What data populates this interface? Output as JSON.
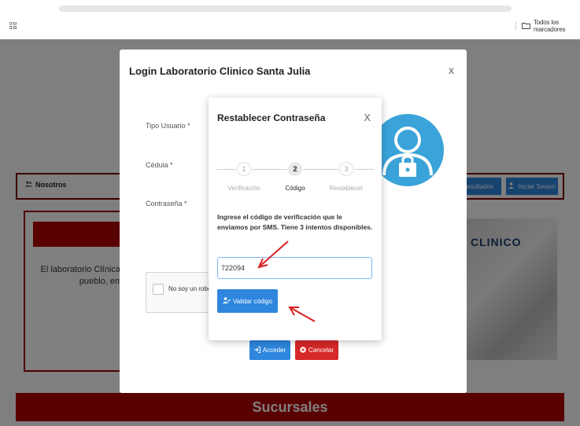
{
  "browser": {
    "bookmarks_label": "Todos los marcadores"
  },
  "page": {
    "nav_nosotros": "Nosotros",
    "nav_resultados": "Resultados",
    "nav_iniciar_sesion": "Iniciar Sesion",
    "about_text": "El laboratorio Clínica Santa Julia, Salud del pueblo, empresa en un",
    "sucursales": "Sucursales",
    "logo_text": "CLINICO"
  },
  "login_modal": {
    "title": "Login Laboratorio Clinico Santa Julia",
    "close": "x",
    "tipo_usuario_label": "Tipo Usuario *",
    "cedula_label": "Cédula *",
    "contrasena_label": "Contraseña *",
    "recaptcha_label": "No soy un robot",
    "acceder": "Acceder",
    "cancelar": "Cancelar"
  },
  "reset_modal": {
    "title": "Restablecer Contraseña",
    "close": "X",
    "steps": [
      {
        "num": "1",
        "label": "Verificación"
      },
      {
        "num": "2",
        "label": "Código"
      },
      {
        "num": "3",
        "label": "Restablecer"
      }
    ],
    "active_step": 2,
    "info": "Ingrese el código de verificación que le enviamos por SMS. Tiene 3 intentos disponibles.",
    "code_value": "722094",
    "validate_button": "Validar código"
  },
  "colors": {
    "brand_red": "#b30000",
    "primary_blue": "#2e86de",
    "danger_red": "#d62828",
    "annotation_arrow": "#d62020"
  }
}
